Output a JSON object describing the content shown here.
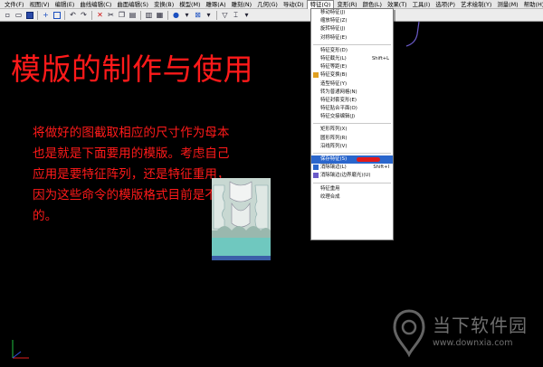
{
  "menubar": {
    "items": [
      {
        "label": "文件(F)"
      },
      {
        "label": "视图(V)"
      },
      {
        "label": "编辑(E)"
      },
      {
        "label": "曲线编辑(C)"
      },
      {
        "label": "曲面编辑(S)"
      },
      {
        "label": "变换(B)"
      },
      {
        "label": "模型(M)"
      },
      {
        "label": "雕琢(A)"
      },
      {
        "label": "雕刻(N)"
      },
      {
        "label": "几何(G)"
      },
      {
        "label": "导动(D)"
      },
      {
        "label": "特征(Q)"
      },
      {
        "label": "变形(R)"
      },
      {
        "label": "颜色(L)"
      },
      {
        "label": "效果(T)"
      },
      {
        "label": "工具(I)"
      },
      {
        "label": "选项(P)"
      },
      {
        "label": "艺术绘制(Y)"
      },
      {
        "label": "测量(M)"
      },
      {
        "label": "帮助(H)"
      }
    ],
    "active_index": 11
  },
  "canvas": {
    "title": "模版的制作与使用",
    "description": [
      "将做好的图截取相应的尺寸作为母本",
      "也是就是下面要用的模版。考虑自己",
      "应用是要特征阵列，还是特征重用，",
      "因为这些命令的模版格式目前是不统一",
      "的。"
    ]
  },
  "dropdown": {
    "groups": [
      [
        {
          "label": "移动特征(J)",
          "shortcut": ""
        },
        {
          "label": "缩放特征(Z)",
          "shortcut": ""
        },
        {
          "label": "旋转特征(J)",
          "shortcut": ""
        },
        {
          "label": "对称特征(E)",
          "shortcut": ""
        }
      ],
      [
        {
          "label": "特征变形(D)",
          "shortcut": ""
        },
        {
          "label": "特征截光(L)",
          "shortcut": "Shift+L"
        },
        {
          "label": "特征等距(E)",
          "shortcut": ""
        },
        {
          "label": "特征变换(B)",
          "shortcut": ""
        },
        {
          "label": "造型特征(Y)",
          "shortcut": ""
        },
        {
          "label": "转为普通网格(N)",
          "shortcut": ""
        },
        {
          "label": "特征封套变形(E)",
          "shortcut": ""
        },
        {
          "label": "特征贴合平面(O)",
          "shortcut": ""
        },
        {
          "label": "特征交接编辑(J)",
          "shortcut": ""
        }
      ],
      [
        {
          "label": "矩形阵列(X)",
          "shortcut": ""
        },
        {
          "label": "圆形阵列(R)",
          "shortcut": ""
        },
        {
          "label": "沿线阵列(V)",
          "shortcut": ""
        }
      ],
      [
        {
          "label": "保存特征(S)",
          "shortcut": "",
          "highlight": true
        },
        {
          "label": "消除镶边(L)",
          "shortcut": "Shift+I"
        },
        {
          "label": "消除镶边(边界磨光)(U)",
          "shortcut": ""
        }
      ],
      [
        {
          "label": "特征重用",
          "shortcut": ""
        },
        {
          "label": "纹理合成",
          "shortcut": ""
        }
      ]
    ]
  },
  "watermark": {
    "text": "当下软件园",
    "url": "www.downxia.com"
  },
  "colors": {
    "accent_red": "#ff1a1a",
    "menu_highlight": "#2a66cc",
    "template_teal": "#6fc8bf"
  }
}
